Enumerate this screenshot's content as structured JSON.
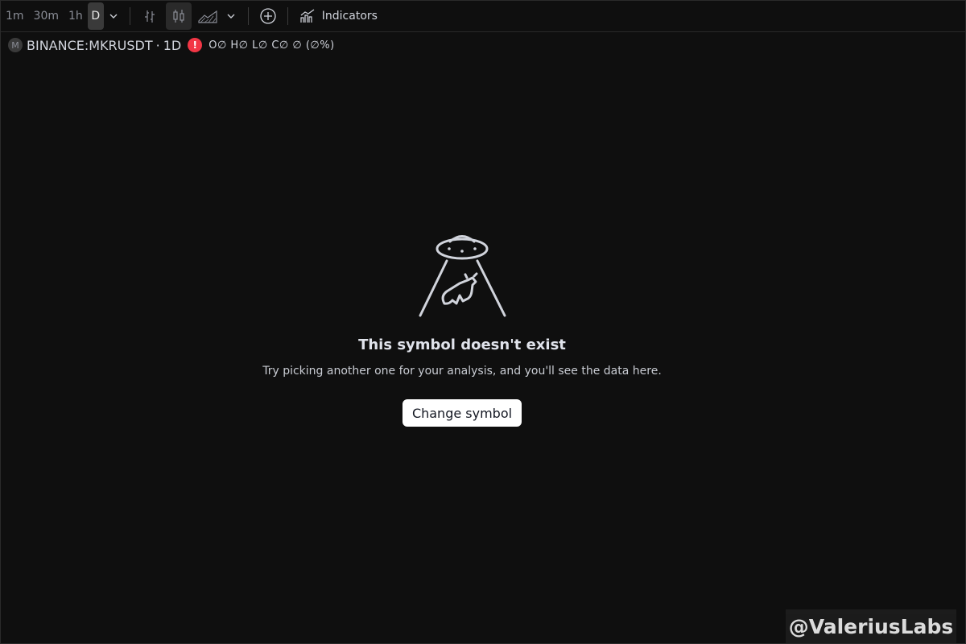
{
  "toolbar": {
    "intervals": [
      "1m",
      "30m",
      "1h"
    ],
    "active_interval": "D",
    "indicators_label": "Indicators"
  },
  "legend": {
    "symbol_avatar": "M",
    "symbol": "BINANCE:MKRUSDT",
    "separator": "·",
    "timeframe": "1D",
    "error_icon": "!",
    "ohlc": "O∅ H∅ L∅ C∅ ∅ (∅%)"
  },
  "empty_state": {
    "title": "This symbol doesn't exist",
    "subtitle": "Try picking another one for your analysis, and you'll see the data here.",
    "button_label": "Change symbol"
  },
  "watermark": "@ValeriusLabs",
  "colors": {
    "background": "#0f0f0f",
    "error": "#f23645",
    "button_bg": "#ffffff"
  }
}
